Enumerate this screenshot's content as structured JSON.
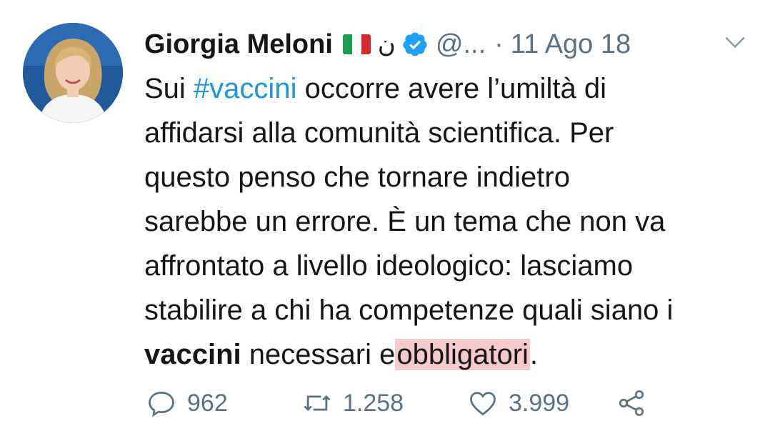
{
  "tweet": {
    "author_name": "Giorgia Meloni",
    "flag": "🇮🇹",
    "extra_glyph": "ن",
    "handle": "@...",
    "separator": "·",
    "date": "11 Ago 18",
    "icons": {
      "verified": "verified-badge-icon",
      "caret": "chevron-down-icon",
      "reply": "reply-icon",
      "retweet": "retweet-icon",
      "like": "heart-icon",
      "share": "share-icon"
    },
    "colors": {
      "hashtag": "#1b95e0",
      "verified": "#1da1f2",
      "muted": "#5b7083",
      "highlight": "#f6c9cd"
    },
    "body": {
      "l1_a": "Sui ",
      "l1_hashtag": "#vaccini",
      "l1_b": " occorre avere l’umiltà di",
      "l2": "affidarsi alla comunità scientifica. Per",
      "l3": "questo penso che tornare indietro",
      "l4": "sarebbe un errore. È un tema che non va",
      "l5": "affrontato a livello ideologico: lasciamo",
      "l6": "stabilire a chi ha competenze quali siano i",
      "l7_bold": "vaccini",
      "l7_a": " necessari e",
      "l7_highlight": "obbligatori",
      "l7_end": "."
    },
    "stats": {
      "replies": "962",
      "retweets": "1.258",
      "likes": "3.999"
    }
  }
}
